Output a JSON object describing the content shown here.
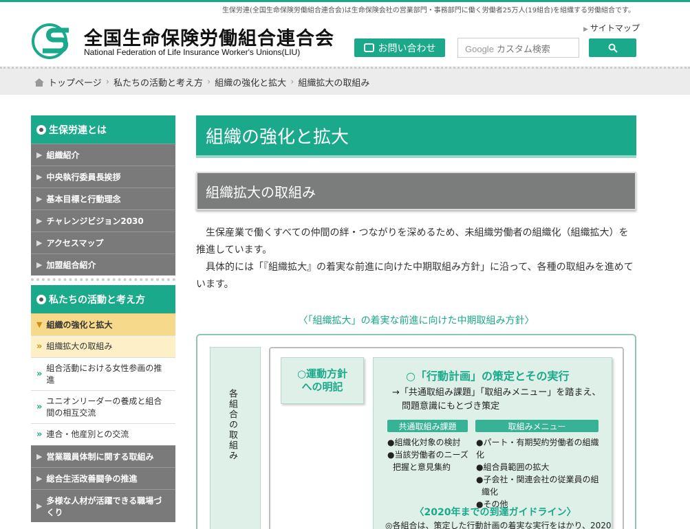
{
  "header": {
    "tagline": "生保労連(全国生命保険労働組合連合会)は生命保険会社の営業部門・事務部門に働く労働者25万人(19組合)を組織する労働組合です。",
    "logo_jp": "全国生命保険労働組合連合会",
    "logo_en": "National Federation of Life Insurance Worker's Unions(LIU)",
    "sitemap": "サイトマップ",
    "contact": "お問い合わせ",
    "search_placeholder": "カスタム検索",
    "search_google": "Google"
  },
  "breadcrumb": [
    "トップページ",
    "私たちの活動と考え方",
    "組織の強化と拡大",
    "組織拡大の取組み"
  ],
  "sidebar": {
    "section1": "生保労連とは",
    "items1": [
      "組織紹介",
      "中央執行委員長挨拶",
      "基本目標と行動理念",
      "チャレンジビジョン2030",
      "アクセスマップ",
      "加盟組合紹介"
    ],
    "section2": "私たちの活動と考え方",
    "active": "組織の強化と拡大",
    "subs": [
      "組織拡大の取組み",
      "組合活動における女性参画の推進",
      "ユニオンリーダーの養成と組合間の相互交流",
      "連合・他産別との交流"
    ],
    "items2": [
      "営業職員体制に関する取組み",
      "総合生活改善闘争の推進",
      "多様な人材が活躍できる職場づくり"
    ]
  },
  "main": {
    "page_title": "組織の強化と拡大",
    "section_title": "組織拡大の取組み",
    "para1": "生保産業で働くすべての仲間の絆・つながりを深めるため、未組織労働者の組織化（組織拡大）を推進しています。",
    "para2": "具体的には「『組織拡大』の着実な前進に向けた中期取組み方針」に沿って、各種の取組みを進めています。"
  },
  "diagram": {
    "caption": "〈「組織拡大」の着実な前進に向けた中期取組み方針〉",
    "left": "各組合の取組み",
    "box1_line1": "○運動方針",
    "box1_line2": "への明記",
    "plan_title": "○「行動計画」の策定とその実行",
    "plan_desc1": "→「共通取組み課題」「取組みメニュー」を踏まえ、",
    "plan_desc2": "問題意識にもとづき策定",
    "label1": "共通取組み課題",
    "label2": "取組みメニュー",
    "list1": [
      "●組織化対象の検討",
      "●当該労働者のニーズ",
      "把握と意見集約"
    ],
    "list2": [
      "●パート・有期契約労働者の組織化",
      "●組合員範囲の拡大",
      "●子会社・関連会社の従業員の組",
      "織化",
      "●その他"
    ],
    "guide_title": "〈2020年までの到達ガイドライン〉",
    "guide_text": "◎各組合は、策定した行動計画の着実な実行をはかり、2020"
  },
  "colors": {
    "brand": "#1aa98a",
    "gray": "#7a7a7a",
    "active": "#f6d98a"
  }
}
